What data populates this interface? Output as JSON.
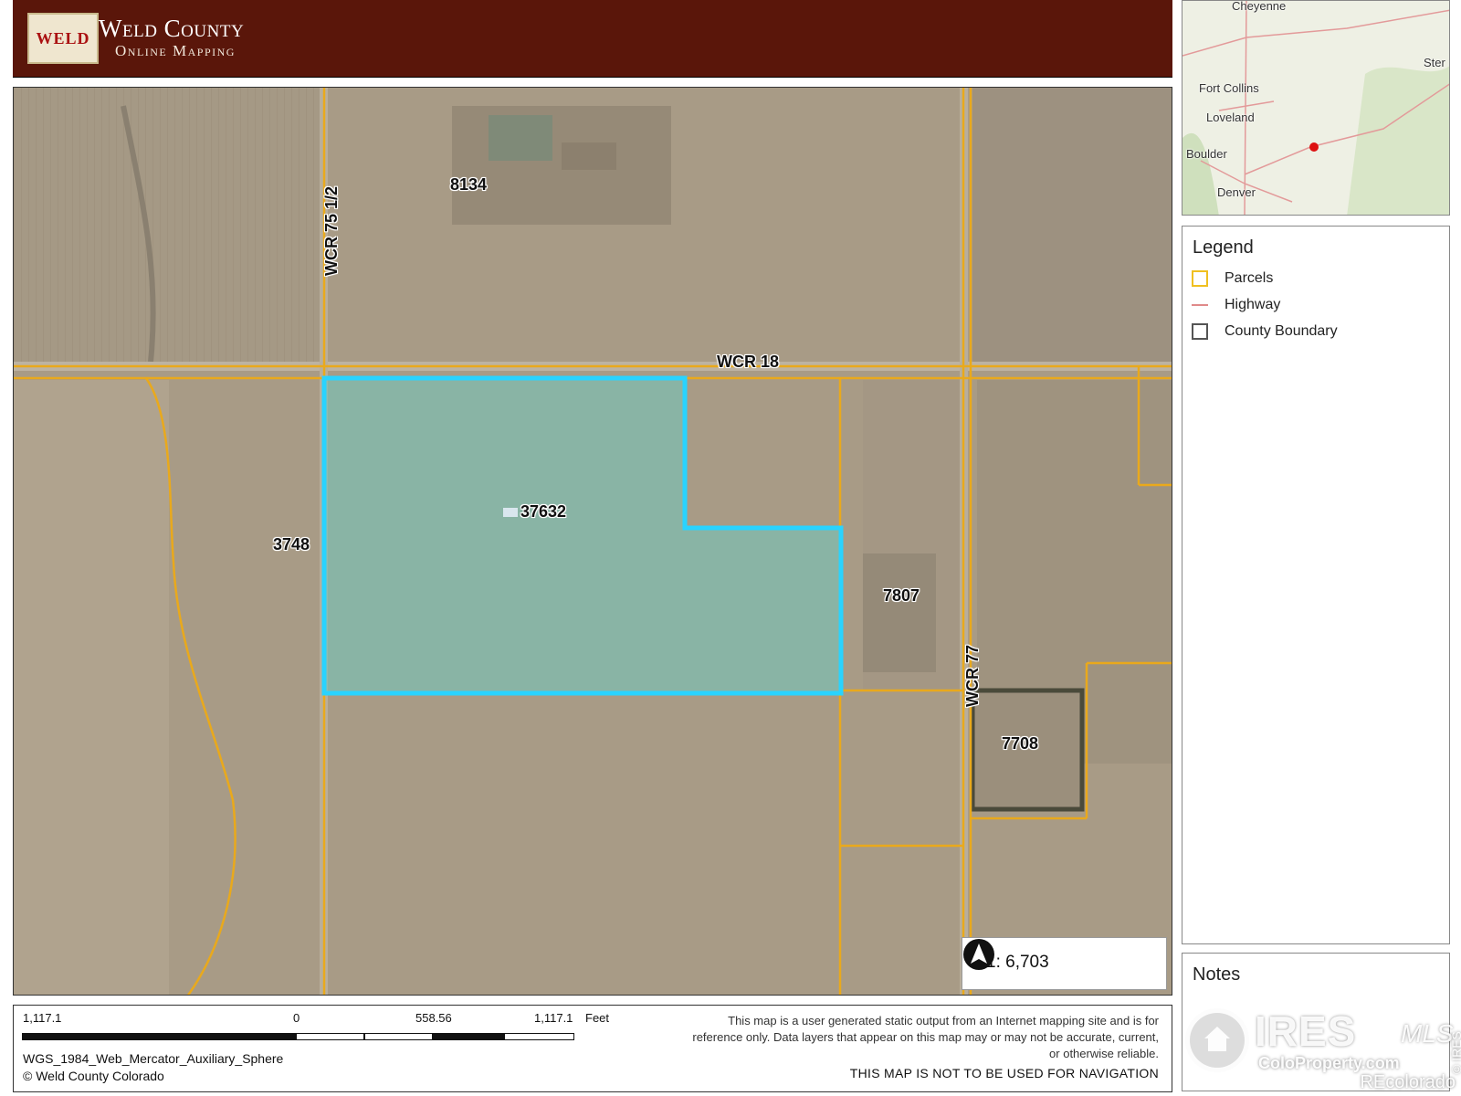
{
  "header": {
    "logo_text": "WELD",
    "title": "Weld County",
    "subtitle": "Online Mapping"
  },
  "map": {
    "road_labels": {
      "wcr_18": "WCR 18",
      "wcr_75_half": "WCR 75 1/2",
      "wcr_77": "WCR 77"
    },
    "parcel_labels": {
      "p8134": "8134",
      "p37632": "37632",
      "p3748": "3748",
      "p7807": "7807",
      "p7708": "7708"
    },
    "scale_ratio": "1: 6,703",
    "colors": {
      "parcel_line": "#e9a91c",
      "selection": "#29d3ff",
      "selection_fill": "#6fc9bf",
      "ground": "#a89b86"
    }
  },
  "inset": {
    "cities": {
      "cheyenne": "Cheyenne",
      "fort_collins": "Fort Collins",
      "loveland": "Loveland",
      "boulder": "Boulder",
      "denver": "Denver",
      "sterling": "Ster"
    },
    "marker_color": "#d11"
  },
  "legend": {
    "title": "Legend",
    "items": {
      "parcels": "Parcels",
      "highway": "Highway",
      "county_boundary": "County Boundary"
    }
  },
  "notes": {
    "title": "Notes"
  },
  "footer": {
    "scale_ticks": {
      "left": "1,117.1",
      "zero": "0",
      "mid": "558.56",
      "right": "1,117.1",
      "unit": "Feet"
    },
    "projection": "WGS_1984_Web_Mercator_Auxiliary_Sphere",
    "copyright": "© Weld County Colorado",
    "disclaimer": "This map is a user generated static output from an Internet mapping site and is for reference only. Data layers that appear on this map may or may not be accurate, current, or otherwise reliable.",
    "nav_warning": "THIS MAP IS NOT TO BE USED FOR NAVIGATION"
  },
  "watermark": {
    "ires": "IRES",
    "mls": "MLS",
    "coloproperty": "ColoProperty.com",
    "bottom": "REcolorado",
    "side": "© IRES"
  }
}
